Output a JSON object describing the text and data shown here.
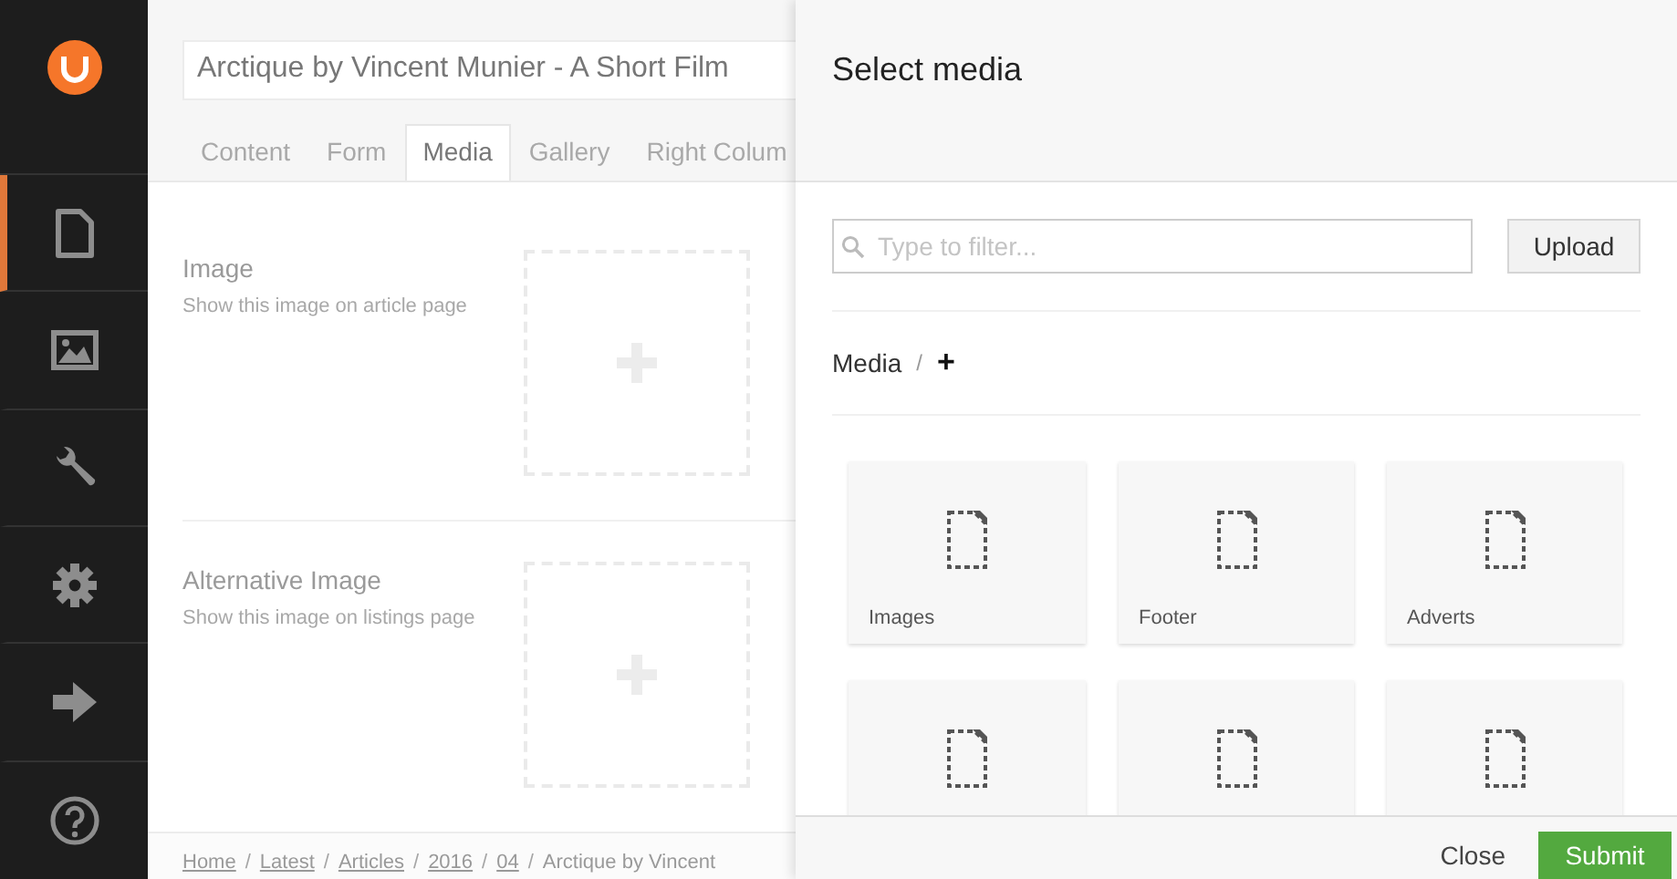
{
  "sidebar": {
    "items": [
      {
        "kind": "document",
        "selected": true
      },
      {
        "kind": "image",
        "selected": false
      },
      {
        "kind": "wrench",
        "selected": false
      },
      {
        "kind": "gear",
        "selected": false
      },
      {
        "kind": "arrow",
        "selected": false
      },
      {
        "kind": "help",
        "selected": false
      }
    ]
  },
  "editor": {
    "title": "Arctique by Vincent Munier - A Short Film",
    "tabs": [
      {
        "label": "Content",
        "selected": false
      },
      {
        "label": "Form",
        "selected": false
      },
      {
        "label": "Media",
        "selected": true
      },
      {
        "label": "Gallery",
        "selected": false
      },
      {
        "label": "Right Colum",
        "selected": false
      }
    ],
    "fields": [
      {
        "label": "Image",
        "description": "Show this image on article page"
      },
      {
        "label": "Alternative Image",
        "description": "Show this image on listings page"
      }
    ],
    "breadcrumb_separator": "/",
    "breadcrumbs": [
      "Home",
      "Latest",
      "Articles",
      "2016",
      "04",
      "Arctique by Vincent"
    ]
  },
  "dialog": {
    "title": "Select media",
    "search": {
      "placeholder": "Type to filter..."
    },
    "upload_button": "Upload",
    "path": {
      "root": "Media",
      "separator": "/",
      "add": "+"
    },
    "items": [
      {
        "kind": "folder",
        "name": "Images"
      },
      {
        "kind": "folder",
        "name": "Footer"
      },
      {
        "kind": "folder",
        "name": "Adverts"
      },
      {
        "kind": "folder"
      },
      {
        "kind": "folder"
      },
      {
        "kind": "folder"
      }
    ],
    "buttons": {
      "close": "Close",
      "submit": "Submit"
    }
  }
}
